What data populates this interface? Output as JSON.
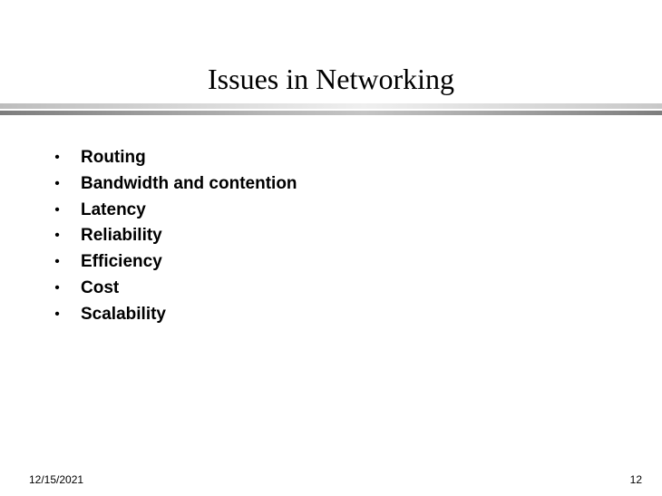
{
  "slide": {
    "title": "Issues in Networking",
    "bullet_glyph": "•",
    "bullets": [
      "Routing",
      "Bandwidth and contention",
      "Latency",
      "Reliability",
      "Efficiency",
      "Cost",
      "Scalability"
    ],
    "footer": {
      "date": "12/15/2021",
      "page_number": "12"
    }
  }
}
